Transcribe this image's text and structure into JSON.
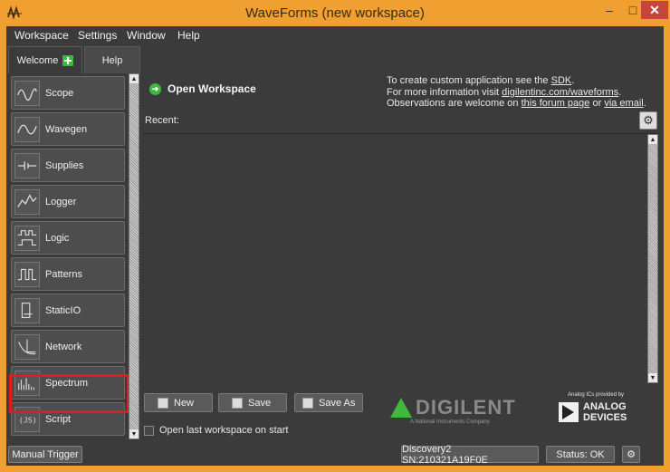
{
  "window": {
    "title": "WaveForms  (new workspace)",
    "controls": {
      "minimize": "–",
      "maximize": "□",
      "close": "✕"
    }
  },
  "menu": [
    "Workspace",
    "Settings",
    "Window",
    "Help"
  ],
  "tabs": [
    {
      "label": "Welcome",
      "active": true
    },
    {
      "label": "Help",
      "active": false
    }
  ],
  "tools": [
    {
      "label": "Scope",
      "icon": "scope-icon"
    },
    {
      "label": "Wavegen",
      "icon": "wavegen-icon"
    },
    {
      "label": "Supplies",
      "icon": "supplies-icon"
    },
    {
      "label": "Logger",
      "icon": "logger-icon"
    },
    {
      "label": "Logic",
      "icon": "logic-icon"
    },
    {
      "label": "Patterns",
      "icon": "patterns-icon"
    },
    {
      "label": "StaticIO",
      "icon": "staticio-icon"
    },
    {
      "label": "Network",
      "icon": "network-icon",
      "highlighted": true
    },
    {
      "label": "Spectrum",
      "icon": "spectrum-icon"
    },
    {
      "label": "Script",
      "icon": "script-icon"
    }
  ],
  "main": {
    "open_title": "Open Workspace",
    "info": {
      "line1_prefix": "To create custom application see the ",
      "line1_link": "SDK",
      "line1_suffix": ".",
      "line2_prefix": "For more information visit ",
      "line2_link": "digilentinc.com/waveforms",
      "line2_suffix": ".",
      "line3_prefix": "Observations are welcome on ",
      "line3_link1": "this forum page",
      "line3_mid": " or ",
      "line3_link2": "via email",
      "line3_suffix": "."
    },
    "recent_label": "Recent:",
    "buttons": {
      "new": "New",
      "save": "Save",
      "save_as": "Save As"
    },
    "open_last_label": "Open last workspace on start",
    "digilent": {
      "name": "DIGILENT",
      "tagline": "A National Instruments Company"
    },
    "analog": {
      "small": "Analog ICs provided by",
      "line1": "ANALOG",
      "line2": "DEVICES"
    }
  },
  "statusbar": {
    "manual_trigger": "Manual Trigger",
    "device": "Discovery2 SN:210321A19F0E",
    "status": "Status: OK"
  }
}
